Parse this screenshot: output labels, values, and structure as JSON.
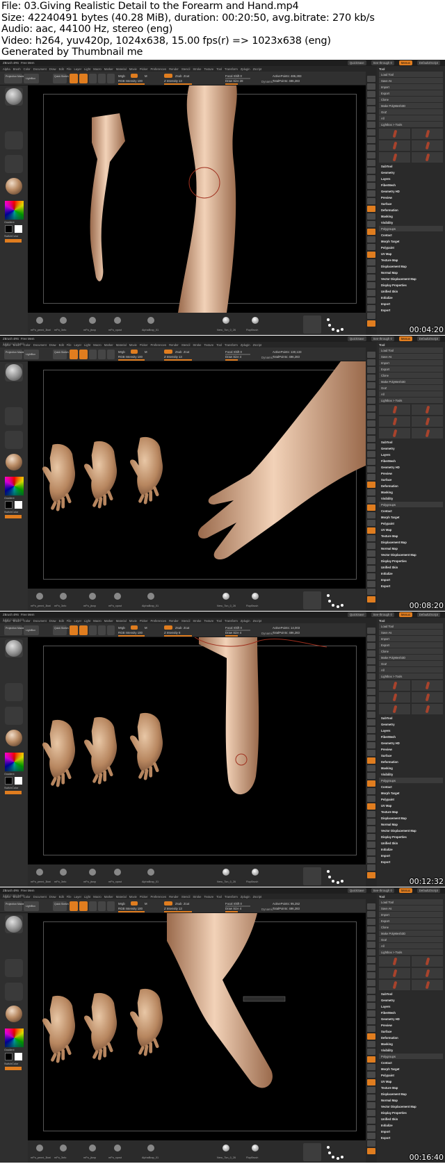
{
  "header": {
    "file": "File: 03.Giving Realistic Detail to the Forearm and Hand.mp4",
    "size": "Size: 42240491 bytes (40.28 MiB), duration: 00:20:50, avg.bitrate: 270 kb/s",
    "audio": "Audio: aac, 44100 Hz, stereo (eng)",
    "video": "Video: h264, yuv420p, 1024x638, 15.00 fps(r) => 1023x638 (eng)",
    "generated": "Generated by Thumbnail me"
  },
  "frames": [
    {
      "timestamp": "00:04:20",
      "coords": "",
      "active_points": "ActivePoints: 486,283",
      "total_points": "TotalPoints: 486,283",
      "focal": "Focal Shift 0",
      "draw_size": "Draw Size 28",
      "z_intensity": "Z Intensity 13",
      "rgb_intensity": "RGB Intensity 100"
    },
    {
      "timestamp": "00:08:20",
      "coords": "3,212,2,171,5,463",
      "active_points": "ActivePoints: 130,133",
      "total_points": "TotalPoints: 486,283",
      "focal": "Focal Shift 0",
      "draw_size": "Draw Size 4",
      "z_intensity": "Z Intensity 13",
      "rgb_intensity": "RGB Intensity 100"
    },
    {
      "timestamp": "00:12:32",
      "coords": "3,212,2,231,5,113",
      "active_points": "ActivePoints: 14,003",
      "total_points": "TotalPoints: 486,283",
      "focal": "Focal Shift 0",
      "draw_size": "Draw Size 4",
      "z_intensity": "Z Intensity 8",
      "rgb_intensity": "RGB Intensity 100"
    },
    {
      "timestamp": "00:16:40",
      "coords": "3,212,2,231,5,459",
      "active_points": "ActivePoints: 95,252",
      "total_points": "TotalPoints: 486,283",
      "focal": "Focal Shift 0",
      "draw_size": "Draw Size 4",
      "z_intensity": "Z Intensity 13",
      "rgb_intensity": "RGB Intensity 100"
    }
  ],
  "ui": {
    "menu_items": [
      "Alpha",
      "Brush",
      "Color",
      "Document",
      "Draw",
      "Edit",
      "File",
      "Layer",
      "Light",
      "Macro",
      "Marker",
      "Material",
      "Movie",
      "Picker",
      "Preferences",
      "Render",
      "Stencil",
      "Stroke",
      "Texture",
      "Tool",
      "Transform",
      "Zplugin",
      "Zscript"
    ],
    "quicksave": "QuickSave",
    "see_through": "See-through 0",
    "menus": "Menus",
    "default_script": "DefaultZScript",
    "projection_master": "Projection Master",
    "lightbox": "LightBox",
    "quick_sketch": "Quick Sketch",
    "edit": "Edit",
    "draw": "Draw",
    "move": "Move",
    "scale": "Scale",
    "rotate": "Rotate",
    "mrgb": "Mrgb",
    "rgb": "Rgb",
    "m": "M",
    "zadd": "Zadd",
    "zsub": "Zsub",
    "zcut": "Zcut",
    "dynamic": "Dynamic",
    "gradient": "Gradient",
    "switch_color": "SwitchColor",
    "alternate": "Alternate",
    "tool_label": "Tool",
    "tray_rows": [
      "Load Tool",
      "Save As",
      "Copy Tool",
      "Paste Tool",
      "Import",
      "Export",
      "Clone",
      "Make PolyMesh3D",
      "GoZ",
      "All",
      "Visible",
      "R",
      "Lightbox > Tools",
      "SubTool",
      "Geometry",
      "Layers",
      "FiberMesh",
      "Geometry HD",
      "Preview",
      "Surface",
      "Deformation",
      "Masking",
      "Visibility",
      "Polygroups",
      "Contact",
      "Morph Target",
      "Polypaint",
      "UV Map",
      "Texture Map",
      "Displacement Map",
      "Normal Map",
      "Vector Displacement Map",
      "Display Properties",
      "Unified Skin",
      "Initialize",
      "Import",
      "Export"
    ],
    "bottom_labels": [
      "mPo_penni_3bat",
      "mPo_3nfo",
      "mPo_jtsnp",
      "mPo_xpost",
      "AlphaBrap_01",
      "Neru_Ton_0_26",
      "FlopBrush"
    ]
  }
}
